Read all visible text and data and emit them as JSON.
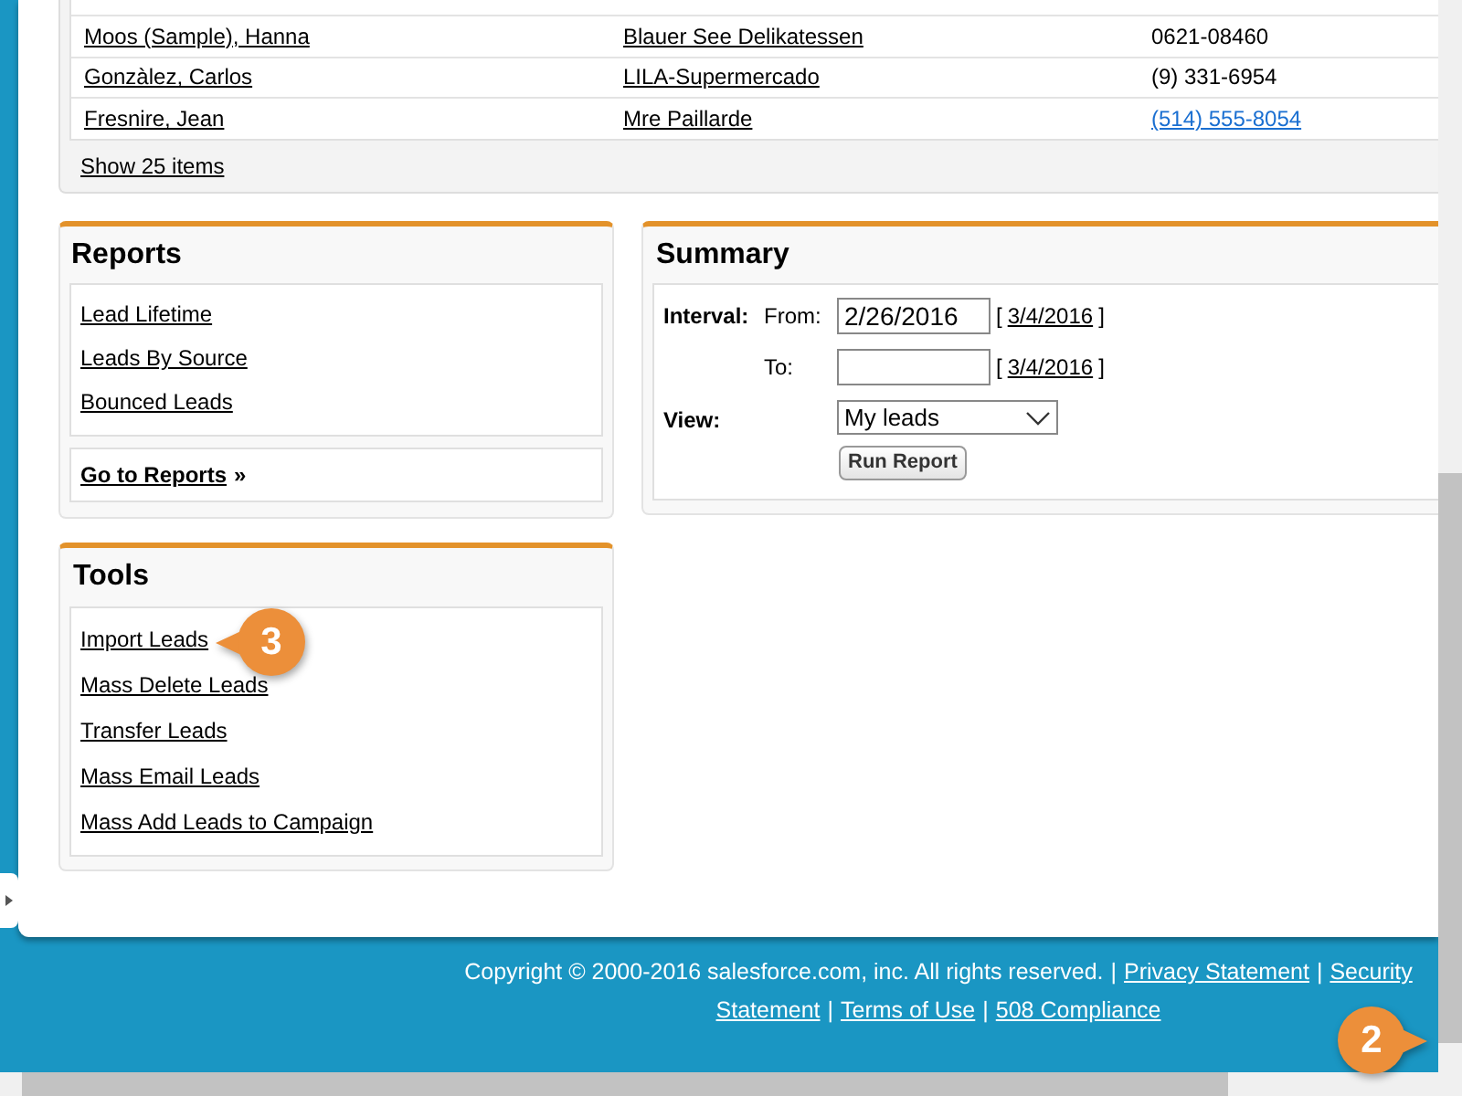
{
  "contacts_table": {
    "rows": [
      {
        "name": "Moos (Sample), Hanna",
        "account": "Blauer See Delikatessen",
        "phone": "0621-08460",
        "kind": "text"
      },
      {
        "name": "Gonzàlez, Carlos",
        "account": "LILA-Supermercado",
        "phone": "(9) 331-6954",
        "kind": "text"
      },
      {
        "name": "Fresnire, Jean",
        "account": "Mre Paillarde",
        "phone": "(514) 555-8054",
        "kind": "link"
      }
    ],
    "show_more": "Show 25 items"
  },
  "reports": {
    "title": "Reports",
    "links": [
      "Lead Lifetime",
      "Leads By Source",
      "Bounced Leads"
    ],
    "go_to": "Go to Reports",
    "go_to_suffix": "»"
  },
  "summary": {
    "title": "Summary",
    "interval_label": "Interval:",
    "from_label": "From:",
    "from_value": "2/26/2016",
    "from_today": {
      "open": "[",
      "date": "3/4/2016",
      "close": "]"
    },
    "to_label": "To:",
    "to_today": {
      "open": "[",
      "date": "3/4/2016",
      "close": "]"
    },
    "view_label": "View:",
    "view_value": "My leads",
    "run_button": "Run Report"
  },
  "tools": {
    "title": "Tools",
    "links": [
      "Import Leads",
      "Mass Delete Leads",
      "Transfer Leads",
      "Mass Email Leads",
      "Mass Add Leads to Campaign"
    ]
  },
  "footer": {
    "lines": [
      [
        {
          "kind": "text",
          "text": "Copyright © 2000-2016 salesforce.com, inc. All rights reserved."
        },
        {
          "kind": "sep",
          "text": "|"
        },
        {
          "kind": "link",
          "text": "Privacy Statement"
        },
        {
          "kind": "sep",
          "text": "|"
        },
        {
          "kind": "link",
          "text": "Security"
        }
      ],
      [
        {
          "kind": "link",
          "text": "Statement"
        },
        {
          "kind": "sep",
          "text": "|"
        },
        {
          "kind": "link",
          "text": "Terms of Use"
        },
        {
          "kind": "sep",
          "text": "|"
        },
        {
          "kind": "link",
          "text": "508 Compliance"
        }
      ]
    ]
  },
  "callouts": [
    {
      "text": "3",
      "kind": "left"
    },
    {
      "text": "2",
      "kind": "right"
    }
  ]
}
